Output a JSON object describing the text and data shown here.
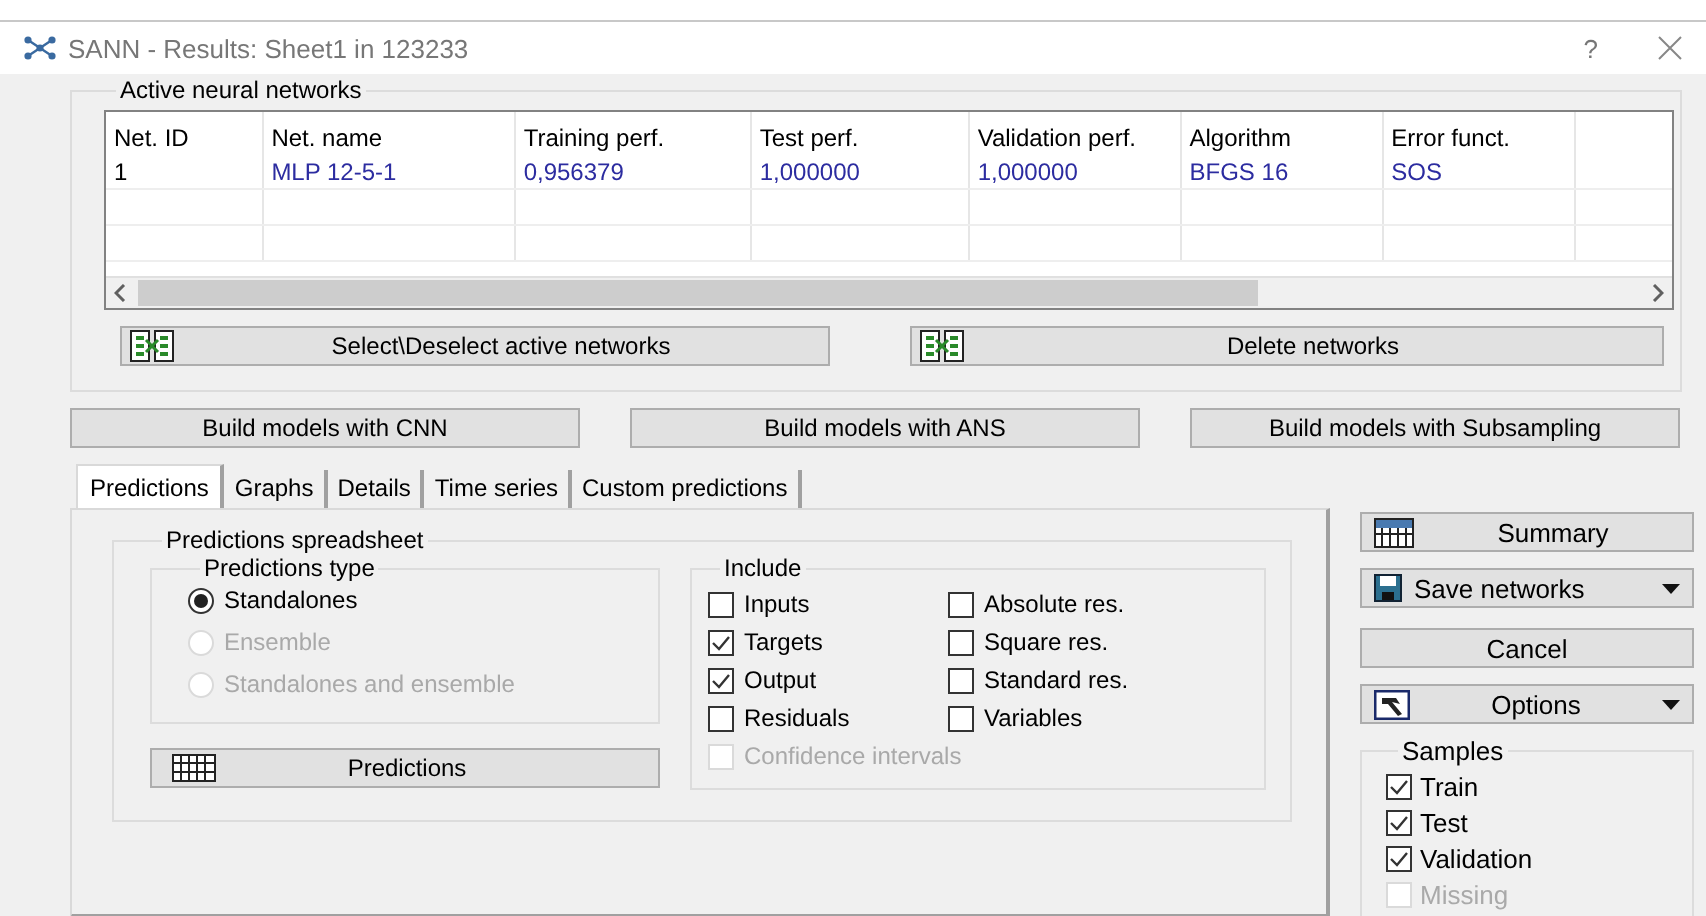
{
  "window": {
    "title": "SANN - Results: Sheet1 in 123233",
    "help": "?"
  },
  "networks": {
    "title": "Active neural networks",
    "columns": [
      "Net. ID",
      "Net. name",
      "Training perf.",
      "Test perf.",
      "Validation perf.",
      "Algorithm",
      "Error funct."
    ],
    "rows": [
      [
        "1",
        "MLP 12-5-1",
        "0,956379",
        "1,000000",
        "1,000000",
        "BFGS 16",
        "SOS"
      ]
    ],
    "buttons": [
      {
        "label": "Select\\Deselect active networks"
      },
      {
        "label": "Delete networks"
      }
    ]
  },
  "build_buttons": [
    "Build models with CNN",
    "Build  models with ANS",
    "Build models with Subsampling"
  ],
  "tabs": [
    {
      "label": "Predictions",
      "selected": true
    },
    {
      "label": "Graphs",
      "selected": false
    },
    {
      "label": "Details",
      "selected": false
    },
    {
      "label": "Time series",
      "selected": false
    },
    {
      "label": "Custom predictions",
      "selected": false
    }
  ],
  "spreadsheet": {
    "title": "Predictions spreadsheet",
    "type_group": {
      "title": "Predictions type",
      "options": [
        {
          "label": "Standalones",
          "selected": true,
          "disabled": false
        },
        {
          "label": "Ensemble",
          "selected": false,
          "disabled": true
        },
        {
          "label": "Standalones and ensemble",
          "selected": false,
          "disabled": true
        }
      ]
    },
    "predictions_button": "Predictions",
    "include": {
      "title": "Include",
      "items": [
        {
          "label": "Inputs",
          "checked": false,
          "disabled": false
        },
        {
          "label": "Absolute res.",
          "checked": false,
          "disabled": false
        },
        {
          "label": "Targets",
          "checked": true,
          "disabled": false
        },
        {
          "label": "Square res.",
          "checked": false,
          "disabled": false
        },
        {
          "label": "Output",
          "checked": true,
          "disabled": false
        },
        {
          "label": "Standard res.",
          "checked": false,
          "disabled": false
        },
        {
          "label": "Residuals",
          "checked": false,
          "disabled": false
        },
        {
          "label": "Variables",
          "checked": false,
          "disabled": false
        },
        {
          "label": "Confidence intervals",
          "checked": false,
          "disabled": true
        }
      ]
    }
  },
  "side_buttons": [
    {
      "kind": "report",
      "label": "Summary"
    },
    {
      "kind": "save-menu",
      "label": "Save networks"
    },
    {
      "kind": "plain",
      "label": "Cancel"
    },
    {
      "kind": "options-menu",
      "label": "Options"
    }
  ],
  "samples": {
    "title": "Samples",
    "items": [
      {
        "label": "Train",
        "checked": true,
        "disabled": false
      },
      {
        "label": "Test",
        "checked": true,
        "disabled": false
      },
      {
        "label": "Validation",
        "checked": true,
        "disabled": false
      },
      {
        "label": "Missing",
        "checked": false,
        "disabled": true
      }
    ]
  }
}
